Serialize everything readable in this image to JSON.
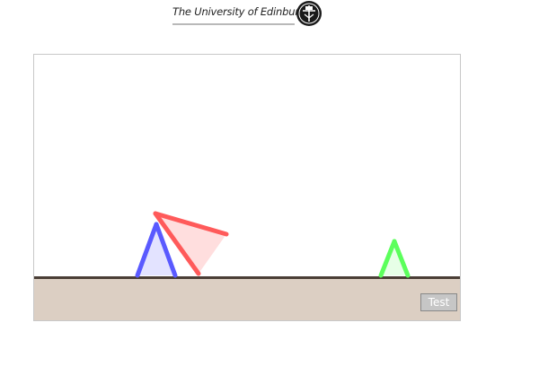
{
  "header": {
    "university_name": "The University of Edinburgh",
    "crest_icon": "university-crest-icon"
  },
  "game": {
    "test_label": "Test",
    "ground_color": "#dccfc3",
    "structures": [
      {
        "name": "blue-a-frame",
        "color": "#5a5aff",
        "fill": "#e3e3ff"
      },
      {
        "name": "red-tilted-triangle",
        "color": "#ff5a5a",
        "fill": "#ffd8d8"
      },
      {
        "name": "green-a-frame",
        "color": "#5cff5c",
        "fill": "#e7ffe7"
      }
    ]
  }
}
